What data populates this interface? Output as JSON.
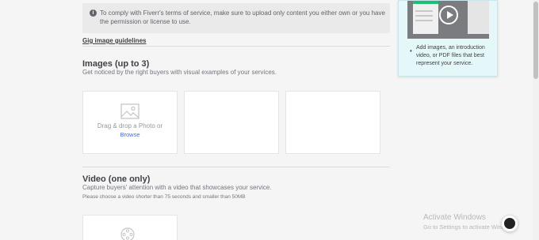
{
  "notice": {
    "icon": "info-icon",
    "text": "To comply with Fiverr's terms of service, make sure to upload only content you either own or you have the permission or license to use."
  },
  "guidelines_link": "Gig image guidelines",
  "images_section": {
    "title": "Images (up to 3)",
    "description": "Get noticed by the right buyers with visual examples of your services.",
    "upload": {
      "icon": "photo-icon",
      "drag_text": "Drag & drop a Photo or",
      "browse_label": "Browse"
    }
  },
  "video_section": {
    "title": "Video (one only)",
    "description": "Capture buyers' attention with a video that showcases your service.",
    "note": "Please choose a video shorter than 75 seconds and smaller than 50MB",
    "icon": "film-icon"
  },
  "tips_card": {
    "play_icon": "play-icon",
    "tip": "Add images, an introduction video, or PDF files that best represent your service."
  },
  "windows_activation": {
    "title": "Activate Windows",
    "subtitle": "Go to Settings to activate Windows."
  },
  "colors": {
    "page_bg": "#f5f5f5",
    "tips_bg": "#e4f7f9",
    "link_blue": "#446ee7",
    "fiverr_green": "#1dbf73"
  }
}
